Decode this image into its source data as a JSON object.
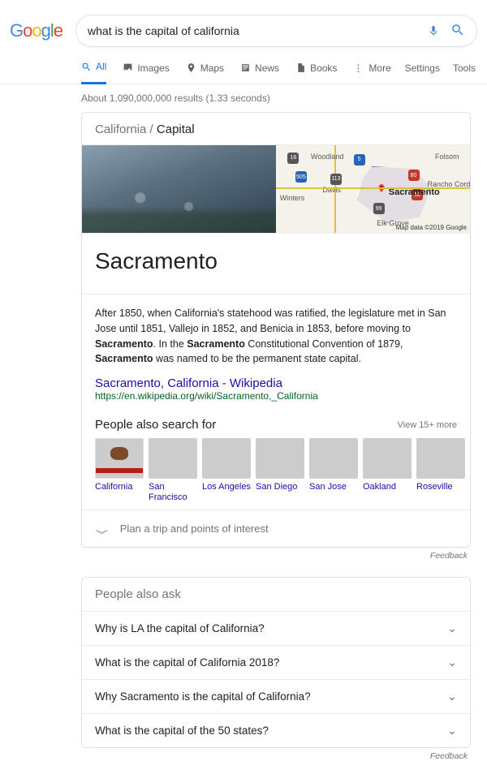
{
  "search": {
    "query": "what is the capital of california"
  },
  "tabs": {
    "all": "All",
    "images": "Images",
    "maps": "Maps",
    "news": "News",
    "books": "Books",
    "more": "More",
    "settings": "Settings",
    "tools": "Tools"
  },
  "stats": "About 1,090,000,000 results (1.33 seconds)",
  "breadcrumb": {
    "parent": "California",
    "sep": "/",
    "child": "Capital"
  },
  "map": {
    "labels": {
      "woodland": "Woodland",
      "winters": "Winters",
      "davis": "Davis",
      "sacramento": "Sacramento",
      "folsom": "Folsom",
      "rancho": "Rancho Cordova",
      "elkgrove": "Elk Grove"
    },
    "hwy": {
      "h16": "16",
      "h505": "505",
      "h5": "5",
      "h113": "113",
      "h80": "80",
      "h50": "50",
      "h99": "99"
    },
    "credit": "Map data ©2019 Google"
  },
  "answer": "Sacramento",
  "desc": {
    "p1": "After 1850, when California's statehood was ratified, the legislature met in San Jose until 1851, Vallejo in 1852, and Benicia in 1853, before moving to ",
    "b1": "Sacramento",
    "p2": ". In the ",
    "b2": "Sacramento",
    "p3": " Constitutional Convention of 1879, ",
    "b3": "Sacramento",
    "p4": " was named to be the permanent state capital."
  },
  "wiki": {
    "title": "Sacramento, California - Wikipedia",
    "url": "https://en.wikipedia.org/wiki/Sacramento,_California"
  },
  "pas": {
    "title": "People also search for",
    "more": "View 15+ more",
    "items": [
      "California",
      "San Francisco",
      "Los Angeles",
      "San Diego",
      "San Jose",
      "Oakland",
      "Roseville"
    ]
  },
  "trip": "Plan a trip and points of interest",
  "feedback": "Feedback",
  "paa": {
    "title": "People also ask",
    "questions": [
      "Why is LA the capital of California?",
      "What is the capital of California 2018?",
      "Why Sacramento is the capital of California?",
      "What is the capital of the 50 states?"
    ]
  }
}
